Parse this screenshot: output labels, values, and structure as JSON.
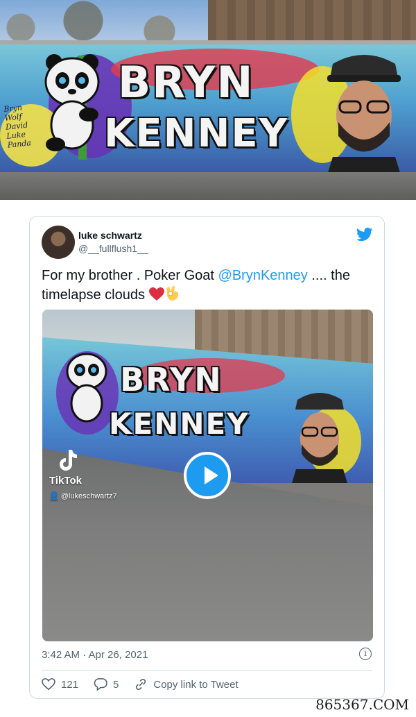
{
  "mural": {
    "tag_lines": [
      "Bryn",
      "Wolf",
      "David",
      "Luke",
      "Panda"
    ],
    "graffiti_line1": "BRYN",
    "graffiti_line2": "KENNEY"
  },
  "tweet": {
    "author_name": "luke schwartz",
    "author_handle": "@__fullflush1__",
    "text_before": "For my brother . Poker Goat ",
    "mention": "@BrynKenney",
    "text_after": " .... the timelapse clouds ",
    "video": {
      "platform_label": "TikTok",
      "platform_user": "@lukeschwartz7"
    },
    "timestamp": "3:42 AM · Apr 26, 2021",
    "likes": "121",
    "replies": "5",
    "copy_link_label": "Copy link to Tweet"
  },
  "icons": {
    "brand": "twitter-bird-icon",
    "heart": "heart-icon",
    "reply": "reply-icon",
    "link": "link-icon",
    "info": "info-icon",
    "play": "play-icon"
  },
  "colors": {
    "accent": "#1d9bf0",
    "text": "#0f1419",
    "muted": "#536471",
    "border": "#cfd9de"
  },
  "watermark": "865367.COM"
}
